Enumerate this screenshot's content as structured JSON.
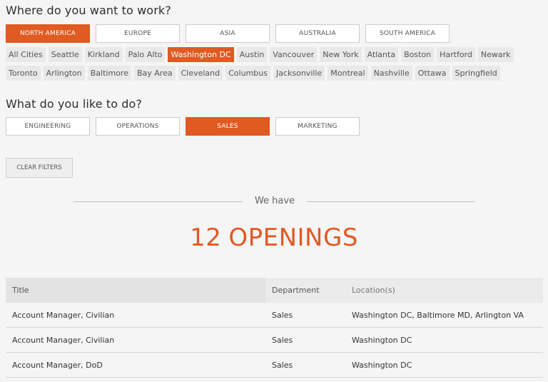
{
  "colors": {
    "accent": "#e05a22",
    "background": "#f5f5f5",
    "pill_border": "#cccccc",
    "city_chip": "#e9e9e9"
  },
  "where": {
    "title": "Where do you want to work?",
    "regions": [
      {
        "label": "NORTH AMERICA",
        "selected": true
      },
      {
        "label": "EUROPE",
        "selected": false
      },
      {
        "label": "ASIA",
        "selected": false
      },
      {
        "label": "AUSTRALIA",
        "selected": false
      },
      {
        "label": "SOUTH AMERICA",
        "selected": false
      }
    ],
    "cities_row1": [
      {
        "label": "All Cities",
        "selected": false
      },
      {
        "label": "Seattle",
        "selected": false
      },
      {
        "label": "Kirkland",
        "selected": false
      },
      {
        "label": "Palo Alto",
        "selected": false
      },
      {
        "label": "Washington DC",
        "selected": true
      },
      {
        "label": "Austin",
        "selected": false
      },
      {
        "label": "Vancouver",
        "selected": false
      },
      {
        "label": "New York",
        "selected": false
      },
      {
        "label": "Atlanta",
        "selected": false
      },
      {
        "label": "Boston",
        "selected": false
      },
      {
        "label": "Hartford",
        "selected": false
      },
      {
        "label": "Newark",
        "selected": false
      }
    ],
    "cities_row2": [
      {
        "label": "Toronto",
        "selected": false
      },
      {
        "label": "Arlington",
        "selected": false
      },
      {
        "label": "Baltimore",
        "selected": false
      },
      {
        "label": "Bay Area",
        "selected": false
      },
      {
        "label": "Cleveland",
        "selected": false
      },
      {
        "label": "Columbus",
        "selected": false
      },
      {
        "label": "Jacksonville",
        "selected": false
      },
      {
        "label": "Montreal",
        "selected": false
      },
      {
        "label": "Nashville",
        "selected": false
      },
      {
        "label": "Ottawa",
        "selected": false
      },
      {
        "label": "Springfield",
        "selected": false
      }
    ]
  },
  "what": {
    "title": "What do you like to do?",
    "activities": [
      {
        "label": "ENGINEERING",
        "selected": false
      },
      {
        "label": "OPERATIONS",
        "selected": false
      },
      {
        "label": "SALES",
        "selected": true
      },
      {
        "label": "MARKETING",
        "selected": false
      }
    ]
  },
  "clear_filters_label": "CLEAR FILTERS",
  "summary": {
    "we_have": "We have",
    "count": "12",
    "openings_word": "OPENINGS"
  },
  "table": {
    "headers": {
      "title": "Title",
      "department": "Department",
      "locations": "Location(s)"
    },
    "rows": [
      {
        "title": "Account Manager, Civilian",
        "department": "Sales",
        "locations": "Washington DC, Baltimore MD, Arlington VA"
      },
      {
        "title": "Account Manager, Civilian",
        "department": "Sales",
        "locations": "Washington DC"
      },
      {
        "title": "Account Manager, DoD",
        "department": "Sales",
        "locations": "Washington DC"
      }
    ]
  }
}
